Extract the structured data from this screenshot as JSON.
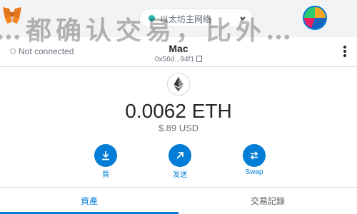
{
  "watermark": "…都确认交易，比外…",
  "network": {
    "label": "以太坊主网络"
  },
  "account": {
    "connection_status": "Not connected",
    "name": "Mac",
    "address": "0x56d...94f1"
  },
  "balance": {
    "amount": "0.0062 ETH",
    "fiat": "$.89 USD"
  },
  "actions": [
    {
      "label": "買",
      "icon": "download-icon"
    },
    {
      "label": "发送",
      "icon": "send-arrow-icon"
    },
    {
      "label": "Swap",
      "icon": "swap-icon"
    }
  ],
  "tabs": [
    {
      "label": "資產",
      "active": true
    },
    {
      "label": "交易記錄",
      "active": false
    }
  ],
  "colors": {
    "accent": "#037dd6",
    "header_bg": "#f2f3f4",
    "network_dot": "#29b6af",
    "text": "#24272a",
    "muted": "#6a737d"
  }
}
